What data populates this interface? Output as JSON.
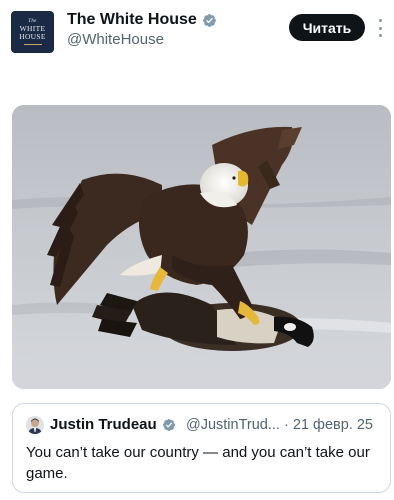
{
  "post": {
    "author": {
      "display_name": "The White House",
      "handle": "@WhiteHouse",
      "verified": true,
      "avatar_lines": [
        "The",
        "WHITE",
        "HOUSE"
      ]
    },
    "read_button_label": "Читать",
    "more_icon": "more-vertical-icon",
    "image_description": "bald-eagle-on-goose-on-ice-photo"
  },
  "quoted_post": {
    "display_name": "Justin Trudeau",
    "handle": "@JustinTrud...",
    "separator": "·",
    "date": "21 февр. 25",
    "verified": true,
    "text": "You can’t take our country — and you can’t take our game."
  },
  "colors": {
    "text_primary": "#0f1419",
    "text_secondary": "#536471",
    "verified_blue": "#1d9bf0",
    "button_bg": "#0f1419",
    "border": "#cfd9de"
  }
}
